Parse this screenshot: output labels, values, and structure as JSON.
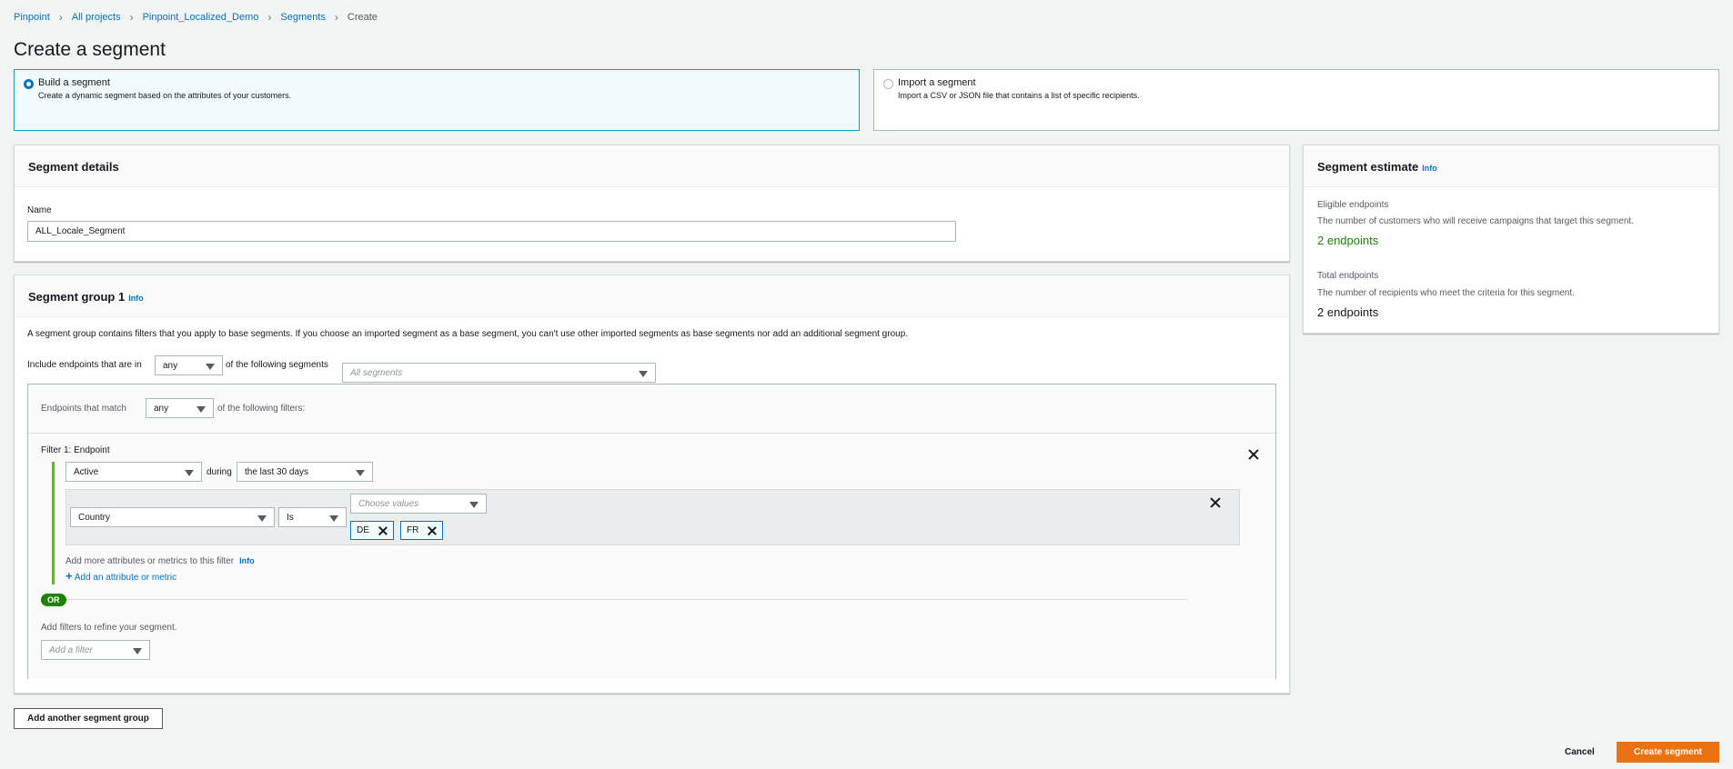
{
  "breadcrumb": {
    "items": [
      "Pinpoint",
      "All projects",
      "Pinpoint_Localized_Demo",
      "Segments"
    ],
    "current": "Create"
  },
  "page_title": "Create a segment",
  "choices": {
    "build": {
      "title": "Build a segment",
      "desc": "Create a dynamic segment based on the attributes of your customers."
    },
    "import": {
      "title": "Import a segment",
      "desc": "Import a CSV or JSON file that contains a list of specific recipients."
    }
  },
  "segment_details": {
    "header": "Segment details",
    "name_label": "Name",
    "name_value": "ALL_Locale_Segment"
  },
  "segment_group": {
    "header": "Segment group 1",
    "info": "Info",
    "description": "A segment group contains filters that you apply to base segments. If you choose an imported segment as a base segment, you can't use other imported segments as base segments nor add an additional segment group.",
    "include_prefix": "Include endpoints that are in",
    "include_value": "any",
    "include_suffix": "of the following segments",
    "segments_placeholder": "All segments",
    "match_prefix": "Endpoints that match",
    "match_value": "any",
    "match_suffix": "of the following filters:",
    "filter_title": "Filter 1: Endpoint",
    "activity_value": "Active",
    "during_label": "during",
    "period_value": "the last 30 days",
    "attribute_value": "Country",
    "operator_value": "Is",
    "values_placeholder": "Choose values",
    "tokens": [
      "DE",
      "FR"
    ],
    "add_more_text": "Add more attributes or metrics to this filter",
    "add_more_info": "Info",
    "add_attribute_link": "Add an attribute or metric",
    "or_label": "OR",
    "refine_text": "Add filters to refine your segment.",
    "add_filter_placeholder": "Add a filter"
  },
  "estimate": {
    "header": "Segment estimate",
    "info": "Info",
    "eligible_label": "Eligible endpoints",
    "eligible_desc": "The number of customers who will receive campaigns that target this segment.",
    "eligible_value": "2 endpoints",
    "total_label": "Total endpoints",
    "total_desc": "The number of recipients who meet the criteria for this segment.",
    "total_value": "2 endpoints"
  },
  "buttons": {
    "add_group": "Add another segment group",
    "cancel": "Cancel",
    "create": "Create segment"
  },
  "colors": {
    "accent": "#0073bb",
    "primary_button": "#ec7211",
    "success": "#1d8102",
    "filter_bar": "#6aaf35"
  }
}
